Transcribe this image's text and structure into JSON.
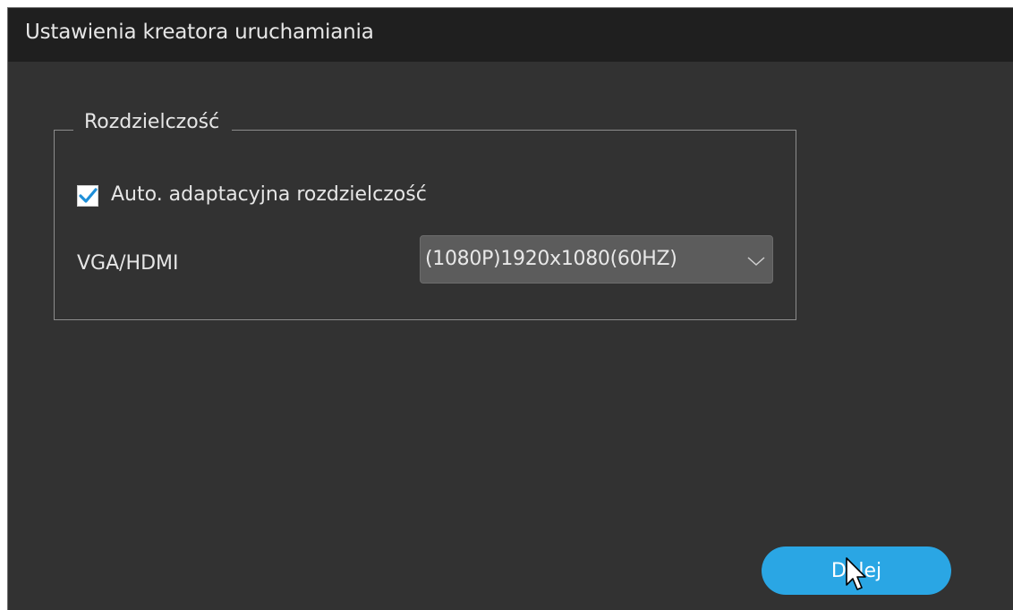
{
  "window": {
    "title": "Ustawienia kreatora uruchamiania"
  },
  "resolution_group": {
    "legend": "Rozdzielczość",
    "auto_adapt": {
      "label": "Auto. adaptacyjna rozdzielczość",
      "checked": true
    },
    "output": {
      "label": "VGA/HDMI",
      "selected": "(1080P)1920x1080(60HZ)"
    }
  },
  "footer": {
    "next_label": "Dalej"
  },
  "icons": {
    "checkmark": "check-icon",
    "dropdown": "chevron-down-icon",
    "pointer": "mouse-cursor-icon"
  },
  "colors": {
    "window_bg": "#323232",
    "titlebar_bg": "#1f1f1f",
    "accent": "#2aa6e4",
    "check": "#1f8fd8",
    "select_bg": "#5c5c5c",
    "text": "#e6e6e6"
  }
}
